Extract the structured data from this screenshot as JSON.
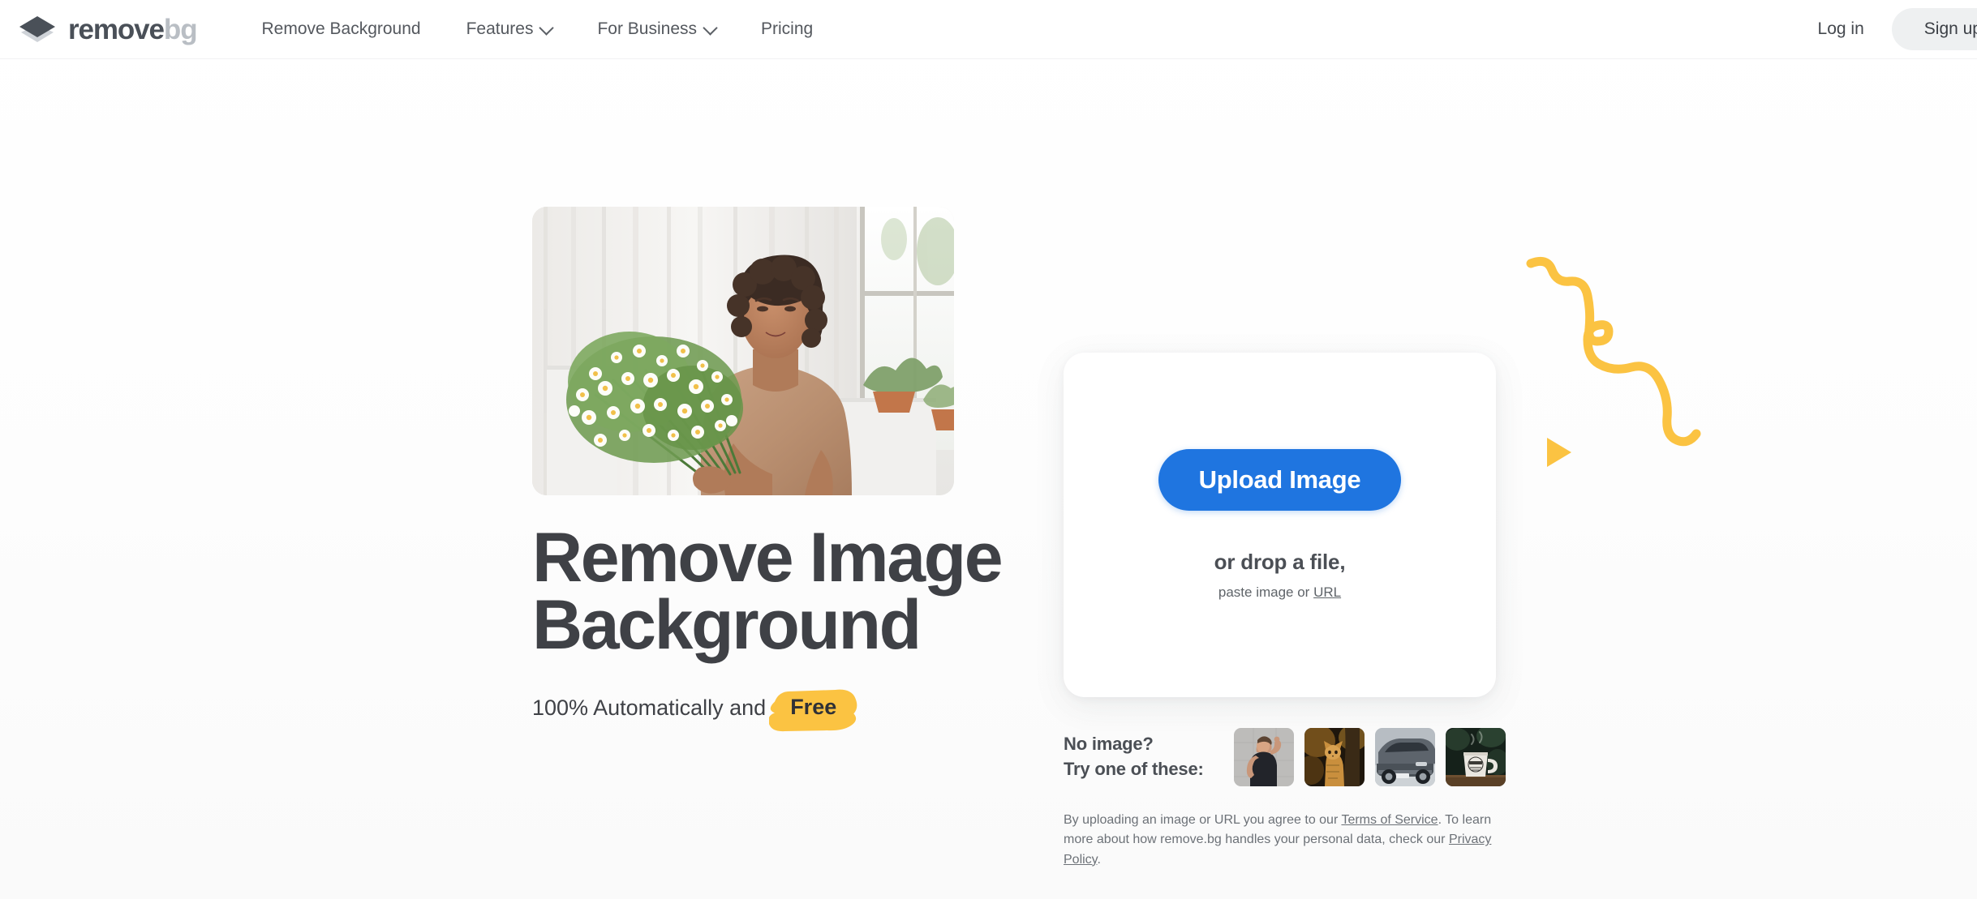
{
  "brand": {
    "name_primary": "remove",
    "name_secondary": "bg",
    "logo_icon": "layered-diamond-icon"
  },
  "header": {
    "nav": [
      {
        "label": "Remove Background",
        "has_dropdown": false
      },
      {
        "label": "Features",
        "has_dropdown": true,
        "icon": "chevron-down-icon"
      },
      {
        "label": "For Business",
        "has_dropdown": true,
        "icon": "chevron-down-icon"
      },
      {
        "label": "Pricing",
        "has_dropdown": false
      }
    ],
    "login_label": "Log in",
    "signup_label": "Sign up"
  },
  "hero": {
    "photo_alt": "woman holding a bouquet of white daisies in a bright room",
    "title_line1": "Remove Image",
    "title_line2": "Background",
    "subtitle_prefix": "100% Automatically and",
    "subtitle_badge": "Free"
  },
  "upload": {
    "button_label": "Upload Image",
    "drop_text": "or drop a file,",
    "paste_prefix": "paste image or",
    "paste_link_label": "URL"
  },
  "samples": {
    "label_line1": "No image?",
    "label_line2": "Try one of these:",
    "thumbnails": [
      {
        "name": "sample-woman-flexing"
      },
      {
        "name": "sample-cat"
      },
      {
        "name": "sample-car"
      },
      {
        "name": "sample-coffee-mug"
      }
    ]
  },
  "legal": {
    "part1": "By uploading an image or URL you agree to our ",
    "terms_link": "Terms of Service",
    "part2": ". To learn more about how remove.bg handles your personal data, check our ",
    "privacy_link": "Privacy Policy",
    "part3": "."
  },
  "decor": {
    "squiggle": "yellow-squiggle-decoration",
    "triangle": "yellow-play-triangle-decoration"
  },
  "colors": {
    "accent_blue": "#1f75e0",
    "accent_yellow": "#fbc342",
    "text_dark": "#3f4146",
    "logo_dark": "#4a5058",
    "logo_light": "#b9bec4"
  }
}
